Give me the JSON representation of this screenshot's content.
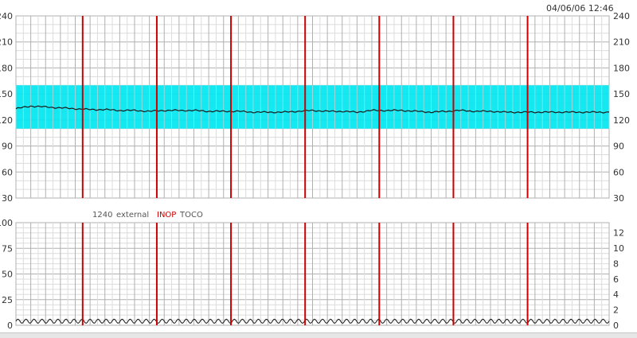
{
  "timestamp": "04/06/06 12:46",
  "status": {
    "code": "1240",
    "mode": "external",
    "inop": "INOP",
    "channel": "TOCO"
  },
  "colors": {
    "fhr_band": "#00e6f0",
    "marker": "#cc0000",
    "trace": "#1a1a1a",
    "grid_major": "#b0b0b0",
    "grid_minor": "#dcdcdc",
    "inop": "#cc0000",
    "status_text": "#555555"
  },
  "chart_data": [
    {
      "type": "line",
      "name": "fhr",
      "ylim": [
        30,
        240
      ],
      "yticks": [
        30,
        60,
        90,
        120,
        150,
        180,
        210,
        240
      ],
      "normal_band": [
        110,
        160
      ],
      "grid": true,
      "x_minutes": [
        0,
        1,
        2,
        3,
        4,
        5,
        6,
        7,
        8,
        9,
        10,
        11,
        12,
        13,
        14,
        15,
        16,
        17,
        18,
        19,
        20,
        21,
        22,
        23,
        24,
        25,
        26,
        27,
        28,
        29,
        30,
        31,
        32,
        33,
        34,
        35,
        36,
        37,
        38,
        39,
        40
      ],
      "values": [
        133,
        136,
        135,
        134,
        133,
        132,
        132,
        131,
        131,
        130,
        131,
        131,
        131,
        130,
        130,
        130,
        129,
        129,
        129,
        130,
        131,
        130,
        130,
        129,
        131,
        131,
        131,
        130,
        129,
        130,
        131,
        130,
        130,
        129,
        129,
        129,
        129,
        129,
        129,
        129,
        129
      ],
      "x_range_minutes": [
        0,
        40
      ],
      "markers_minutes": [
        4.5,
        9.5,
        14.5,
        19.5,
        24.5,
        29.5,
        34.5
      ]
    },
    {
      "type": "line",
      "name": "toco",
      "ylim": [
        0,
        100
      ],
      "yticks": [
        0,
        25,
        50,
        75,
        100
      ],
      "yticks_right": [
        0,
        2,
        4,
        6,
        8,
        10,
        12
      ],
      "ylim_right": [
        0,
        13.3
      ],
      "grid": true,
      "baseline": 4,
      "oscillation_amplitude": 2,
      "oscillation_cycles": 74,
      "x_range_minutes": [
        0,
        40
      ],
      "markers_minutes": [
        4.5,
        9.5,
        14.5,
        19.5,
        24.5,
        29.5,
        34.5
      ]
    }
  ]
}
